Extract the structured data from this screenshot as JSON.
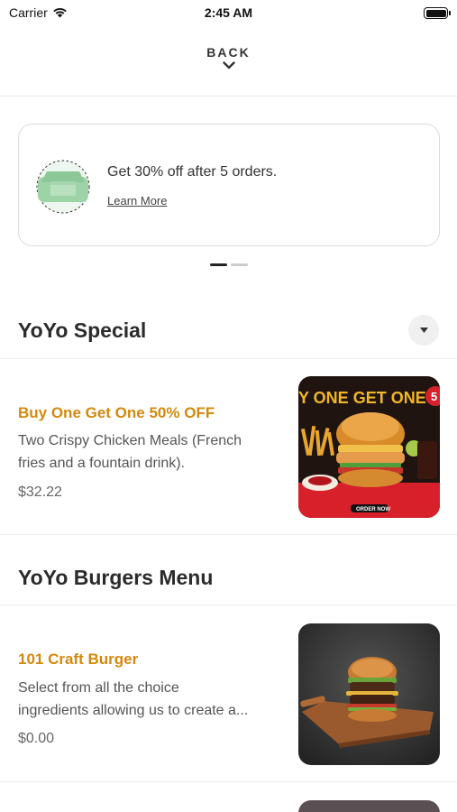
{
  "status_bar": {
    "carrier": "Carrier",
    "time": "2:45 AM"
  },
  "nav": {
    "back_label": "BACK"
  },
  "promo": {
    "text": "Get 30% off after 5 orders.",
    "link": "Learn More",
    "page_count": 2,
    "active_page": 1
  },
  "sections": [
    {
      "title": "YoYo Special",
      "items": [
        {
          "name": "Buy One Get One 50% OFF",
          "description_lines": [
            "Two Crispy Chicken Meals (French",
            "fries and a fountain drink)."
          ],
          "price": "$32.22",
          "image_banner": "Y ONE GET ONE FOR",
          "image_badge": "5",
          "image_button": "ORDER NOW"
        }
      ]
    },
    {
      "title": "YoYo Burgers Menu",
      "items": [
        {
          "name": "101 Craft Burger",
          "description_lines": [
            "Select from all the choice",
            "ingredients allowing us to create a..."
          ],
          "price": "$0.00"
        }
      ]
    }
  ],
  "colors": {
    "accent": "#d4890c",
    "promo_icon_green": "#9dd3a6",
    "special_image_red": "#d8202a"
  }
}
